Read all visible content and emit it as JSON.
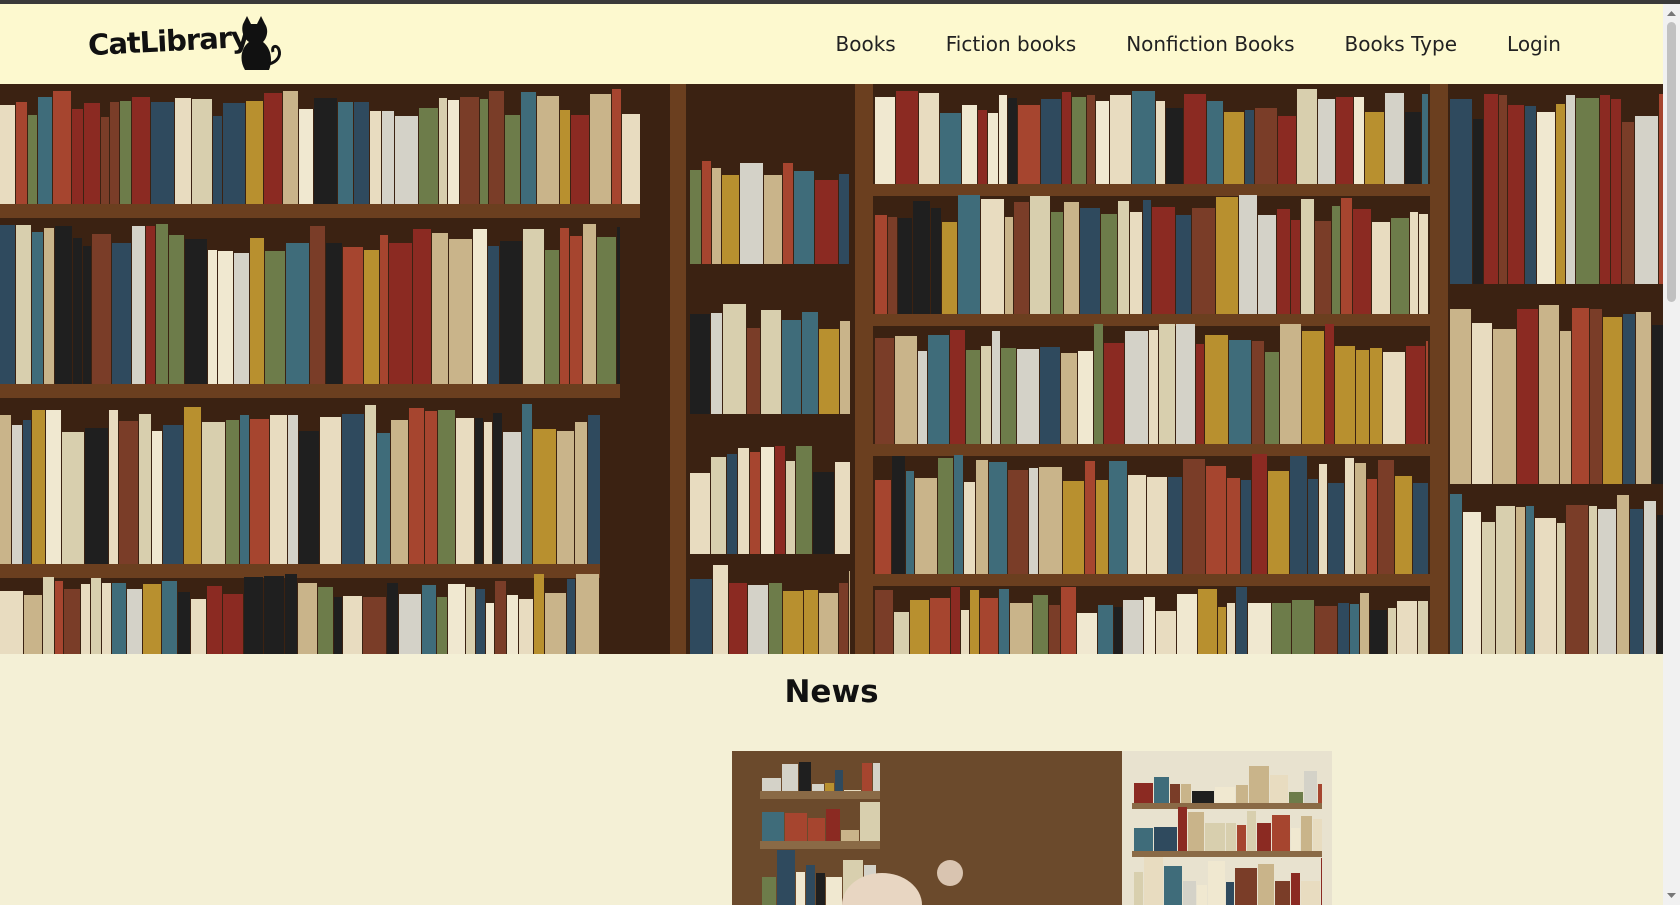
{
  "brand": {
    "logo_text": "CatLibrary"
  },
  "nav": {
    "items": [
      {
        "label": "Books"
      },
      {
        "label": "Fiction books"
      },
      {
        "label": "Nonfiction Books"
      },
      {
        "label": "Books Type"
      },
      {
        "label": "Login"
      }
    ]
  },
  "news": {
    "title": "News"
  },
  "colors": {
    "navbar_bg": "#fdf9cf",
    "page_bg": "#f4f0d6",
    "text": "#222222"
  }
}
